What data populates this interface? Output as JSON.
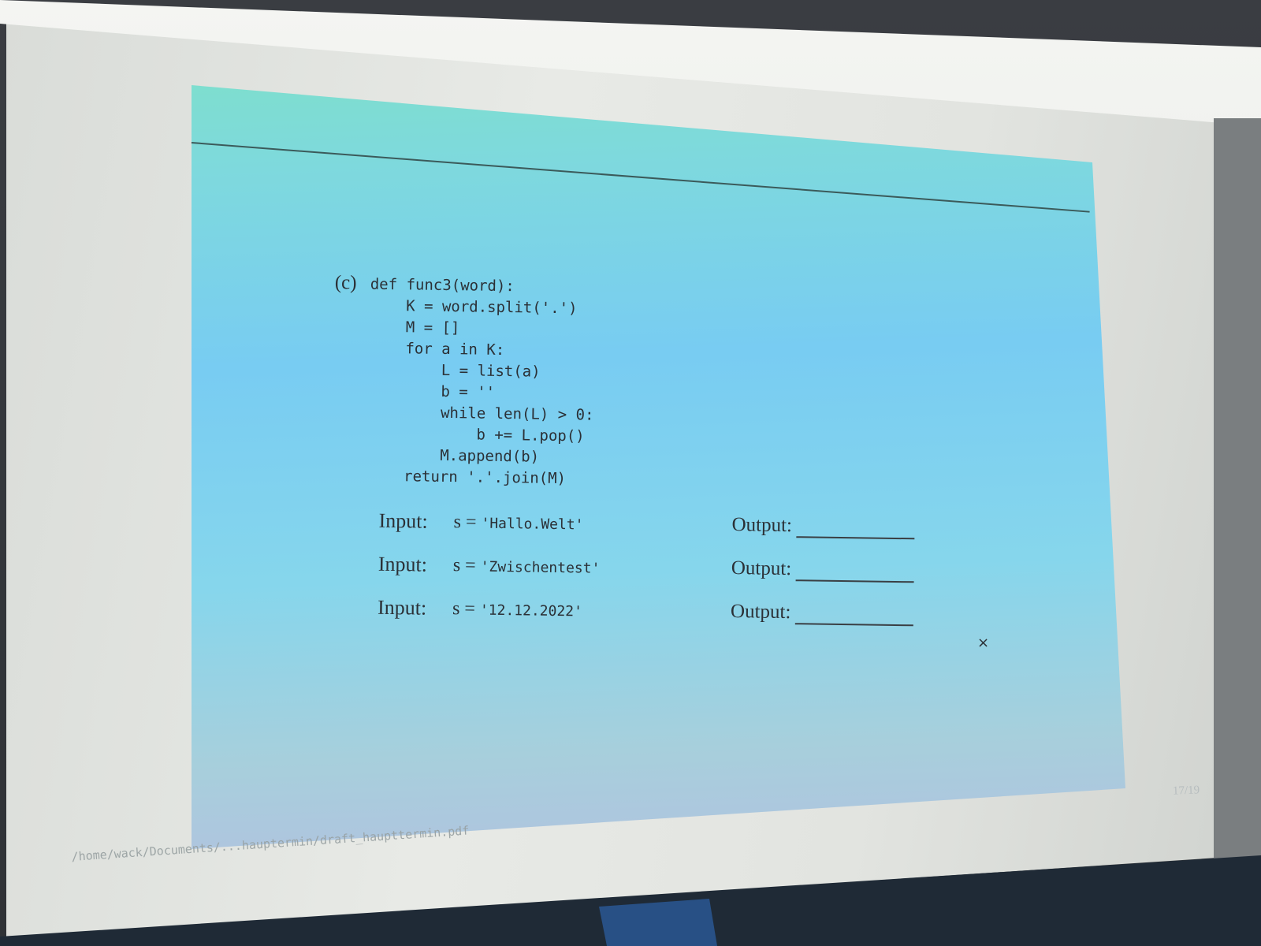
{
  "slide": {
    "part_label": "(c)",
    "code_lines": [
      "def func3(word):",
      "    K = word.split('.')",
      "    M = []",
      "    for a in K:",
      "        L = list(a)",
      "        b = ''",
      "        while len(L) > 0:",
      "            b += L.pop()",
      "        M.append(b)",
      "    return '.'.join(M)"
    ],
    "rows": [
      {
        "input_label": "Input:",
        "var": "s = ",
        "value": "'Hallo.Welt'",
        "output_label": "Output:"
      },
      {
        "input_label": "Input:",
        "var": "s = ",
        "value": "'Zwischentest'",
        "output_label": "Output:"
      },
      {
        "input_label": "Input:",
        "var": "s = ",
        "value": "'12.12.2022'",
        "output_label": "Output:"
      }
    ],
    "close_mark": "×",
    "footer_path": "/home/wack/Documents/...hauptermin/draft_haupttermin.pdf",
    "page_number": "17/19"
  },
  "colors": {
    "slide_top": "#7ee3c0",
    "slide_mid": "#78ccf2",
    "slide_bottom": "#b9b7e2",
    "text": "#2b3036"
  }
}
